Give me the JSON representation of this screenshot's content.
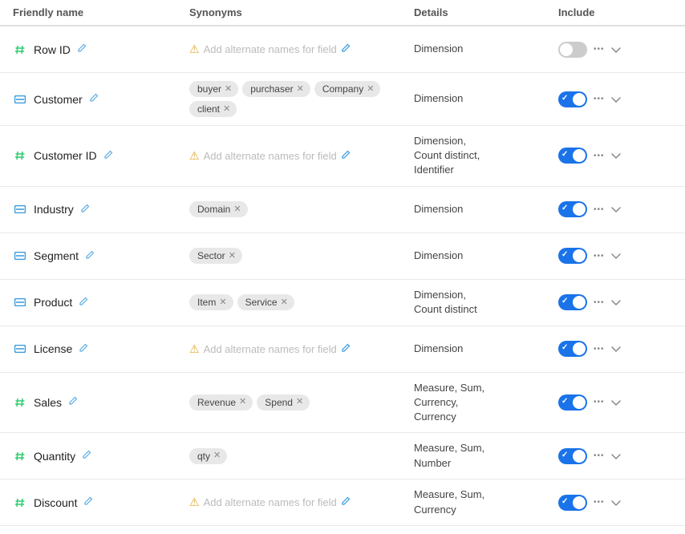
{
  "header": {
    "friendly_name": "Friendly name",
    "synonyms": "Synonyms",
    "details": "Details",
    "include": "Include"
  },
  "rows": [
    {
      "id": "row-id",
      "icon": "hash",
      "name": "Row ID",
      "editable": true,
      "synonyms": [],
      "add_placeholder": "Add alternate names for field",
      "details": "Dimension",
      "enabled": false
    },
    {
      "id": "customer",
      "icon": "string",
      "name": "Customer",
      "editable": true,
      "synonyms": [
        "buyer",
        "purchaser",
        "Company",
        "client"
      ],
      "details": "Dimension",
      "enabled": true
    },
    {
      "id": "customer-id",
      "icon": "hash",
      "name": "Customer ID",
      "editable": true,
      "synonyms": [],
      "add_placeholder": "Add alternate names for field",
      "details": "Dimension,\nCount distinct,\nIdentifier",
      "enabled": true
    },
    {
      "id": "industry",
      "icon": "string",
      "name": "Industry",
      "editable": true,
      "synonyms": [
        "Domain"
      ],
      "details": "Dimension",
      "enabled": true
    },
    {
      "id": "segment",
      "icon": "string",
      "name": "Segment",
      "editable": true,
      "synonyms": [
        "Sector"
      ],
      "details": "Dimension",
      "enabled": true
    },
    {
      "id": "product",
      "icon": "string",
      "name": "Product",
      "editable": true,
      "synonyms": [
        "Item",
        "Service"
      ],
      "details": "Dimension,\nCount distinct",
      "enabled": true
    },
    {
      "id": "license",
      "icon": "string",
      "name": "License",
      "editable": true,
      "synonyms": [],
      "add_placeholder": "Add alternate names for field",
      "details": "Dimension",
      "enabled": true
    },
    {
      "id": "sales",
      "icon": "hash",
      "name": "Sales",
      "editable": true,
      "synonyms": [
        "Revenue",
        "Spend"
      ],
      "details": "Measure, Sum,\nCurrency,\nCurrency",
      "enabled": true
    },
    {
      "id": "quantity",
      "icon": "hash",
      "name": "Quantity",
      "editable": true,
      "synonyms": [
        "qty"
      ],
      "details": "Measure, Sum,\nNumber",
      "enabled": true
    },
    {
      "id": "discount",
      "icon": "hash",
      "name": "Discount",
      "editable": true,
      "synonyms": [],
      "add_placeholder": "Add alternate names for field",
      "details": "Measure, Sum,\nCurrency",
      "enabled": true
    }
  ]
}
